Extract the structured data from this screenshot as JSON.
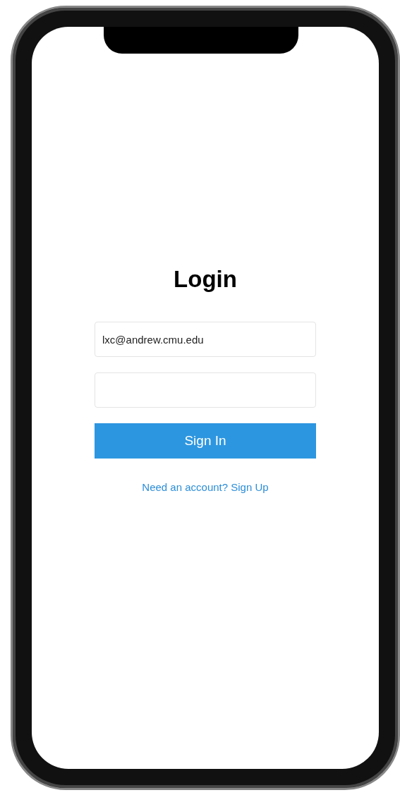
{
  "title": "Login",
  "fields": [
    {
      "kind": "email",
      "value": "lxc@andrew.cmu.edu"
    },
    {
      "kind": "password"
    }
  ],
  "button": "Sign In",
  "link": "Need an account? Sign Up"
}
